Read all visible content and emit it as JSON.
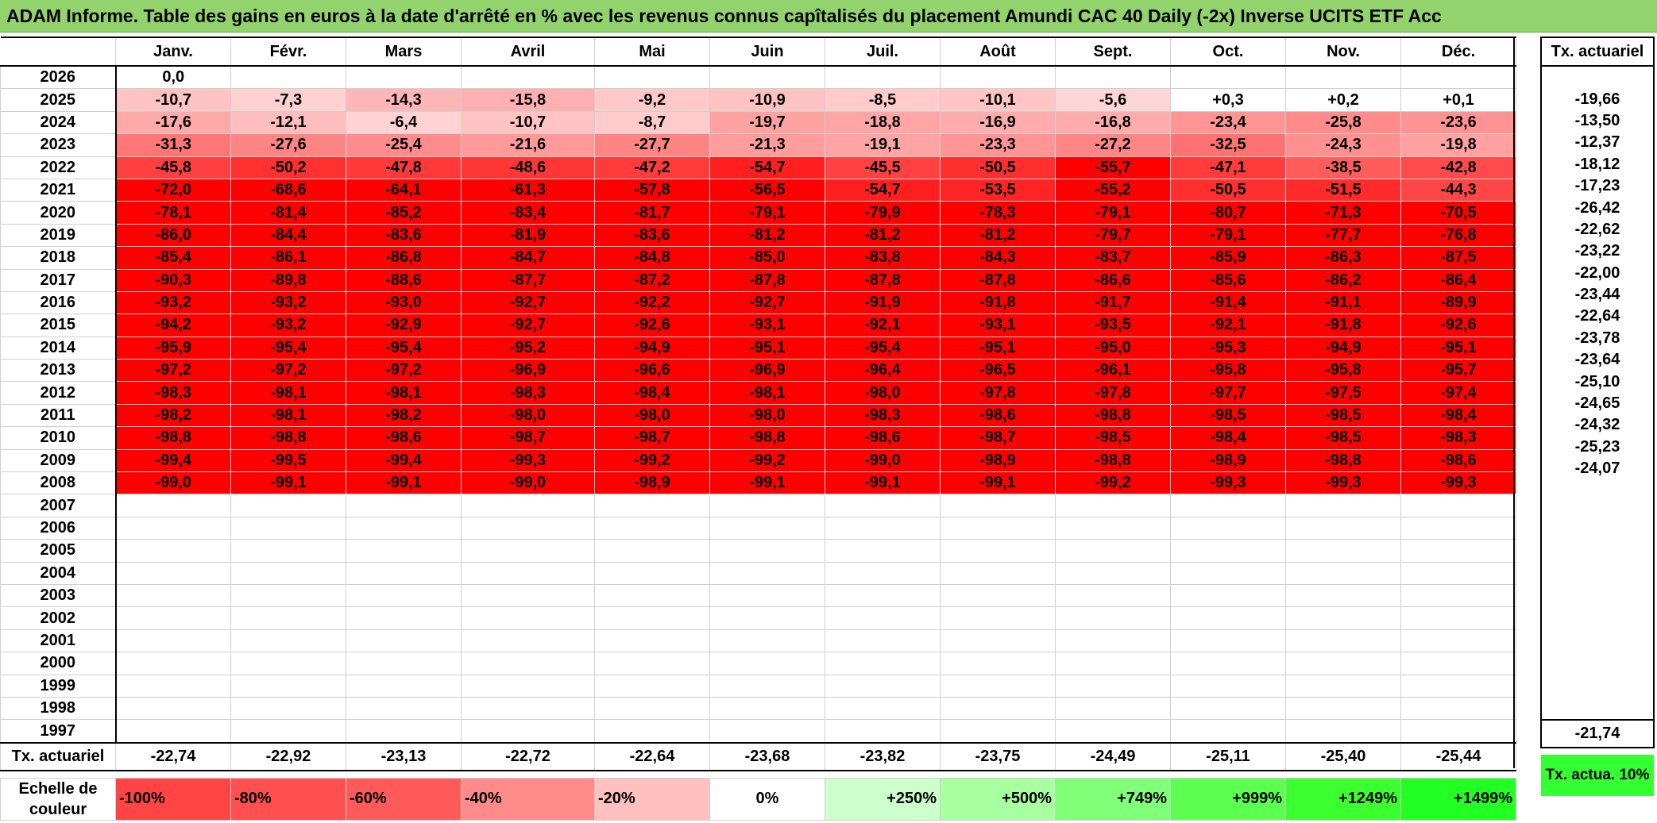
{
  "title": "ADAM Informe. Table des gains en euros à la date d'arrêté en % avec les revenus connus capîtalisés du placement Amundi CAC 40 Daily (-2x) Inverse UCITS ETF Acc",
  "months": [
    "Janv.",
    "Févr.",
    "Mars",
    "Avril",
    "Mai",
    "Juin",
    "Juil.",
    "Août",
    "Sept.",
    "Oct.",
    "Nov.",
    "Déc."
  ],
  "rate_header": "Tx. actuariel",
  "rows": [
    {
      "year": "2026",
      "values": [
        "0,0",
        "",
        "",
        "",
        "",
        "",
        "",
        "",
        "",
        "",
        "",
        ""
      ],
      "rate": ""
    },
    {
      "year": "2025",
      "values": [
        "-10,7",
        "-7,3",
        "-14,3",
        "-15,8",
        "-9,2",
        "-10,9",
        "-8,5",
        "-10,1",
        "-5,6",
        "+0,3",
        "+0,2",
        "+0,1"
      ],
      "rate": "-19,66"
    },
    {
      "year": "2024",
      "values": [
        "-17,6",
        "-12,1",
        "-6,4",
        "-10,7",
        "-8,7",
        "-19,7",
        "-18,8",
        "-16,9",
        "-16,8",
        "-23,4",
        "-25,8",
        "-23,6"
      ],
      "rate": "-13,50"
    },
    {
      "year": "2023",
      "values": [
        "-31,3",
        "-27,6",
        "-25,4",
        "-21,6",
        "-27,7",
        "-21,3",
        "-19,1",
        "-23,3",
        "-27,2",
        "-32,5",
        "-24,3",
        "-19,8"
      ],
      "rate": "-12,37"
    },
    {
      "year": "2022",
      "values": [
        "-45,8",
        "-50,2",
        "-47,8",
        "-48,6",
        "-47,2",
        "-54,7",
        "-45,5",
        "-50,5",
        "-55,7",
        "-47,1",
        "-38,5",
        "-42,8"
      ],
      "rate": "-18,12"
    },
    {
      "year": "2021",
      "values": [
        "-72,0",
        "-68,6",
        "-64,1",
        "-61,3",
        "-57,8",
        "-56,5",
        "-54,7",
        "-53,5",
        "-55,2",
        "-50,5",
        "-51,5",
        "-44,3"
      ],
      "rate": "-17,23"
    },
    {
      "year": "2020",
      "values": [
        "-78,1",
        "-81,4",
        "-85,2",
        "-83,4",
        "-81,7",
        "-79,1",
        "-79,9",
        "-78,3",
        "-79,1",
        "-80,7",
        "-71,3",
        "-70,5"
      ],
      "rate": "-26,42"
    },
    {
      "year": "2019",
      "values": [
        "-86,0",
        "-84,4",
        "-83,6",
        "-81,9",
        "-83,6",
        "-81,2",
        "-81,2",
        "-81,2",
        "-79,7",
        "-79,1",
        "-77,7",
        "-76,8"
      ],
      "rate": "-22,62"
    },
    {
      "year": "2018",
      "values": [
        "-85,4",
        "-86,1",
        "-86,8",
        "-84,7",
        "-84,8",
        "-85,0",
        "-83,8",
        "-84,3",
        "-83,7",
        "-85,9",
        "-86,3",
        "-87,5"
      ],
      "rate": "-23,22"
    },
    {
      "year": "2017",
      "values": [
        "-90,3",
        "-89,8",
        "-88,6",
        "-87,7",
        "-87,2",
        "-87,8",
        "-87,8",
        "-87,8",
        "-86,6",
        "-85,6",
        "-86,2",
        "-86,4"
      ],
      "rate": "-22,00"
    },
    {
      "year": "2016",
      "values": [
        "-93,2",
        "-93,2",
        "-93,0",
        "-92,7",
        "-92,2",
        "-92,7",
        "-91,9",
        "-91,8",
        "-91,7",
        "-91,4",
        "-91,1",
        "-89,9"
      ],
      "rate": "-23,44"
    },
    {
      "year": "2015",
      "values": [
        "-94,2",
        "-93,2",
        "-92,9",
        "-92,7",
        "-92,6",
        "-93,1",
        "-92,1",
        "-93,1",
        "-93,5",
        "-92,1",
        "-91,8",
        "-92,6"
      ],
      "rate": "-22,64"
    },
    {
      "year": "2014",
      "values": [
        "-95,9",
        "-95,4",
        "-95,4",
        "-95,2",
        "-94,9",
        "-95,1",
        "-95,4",
        "-95,1",
        "-95,0",
        "-95,3",
        "-94,9",
        "-95,1"
      ],
      "rate": "-23,78"
    },
    {
      "year": "2013",
      "values": [
        "-97,2",
        "-97,2",
        "-97,2",
        "-96,9",
        "-96,6",
        "-96,9",
        "-96,4",
        "-96,5",
        "-96,1",
        "-95,8",
        "-95,8",
        "-95,7"
      ],
      "rate": "-23,64"
    },
    {
      "year": "2012",
      "values": [
        "-98,3",
        "-98,1",
        "-98,1",
        "-98,3",
        "-98,4",
        "-98,1",
        "-98,0",
        "-97,8",
        "-97,8",
        "-97,7",
        "-97,5",
        "-97,4"
      ],
      "rate": "-25,10"
    },
    {
      "year": "2011",
      "values": [
        "-98,2",
        "-98,1",
        "-98,2",
        "-98,0",
        "-98,0",
        "-98,0",
        "-98,3",
        "-98,6",
        "-98,8",
        "-98,5",
        "-98,5",
        "-98,4"
      ],
      "rate": "-24,65"
    },
    {
      "year": "2010",
      "values": [
        "-98,8",
        "-98,8",
        "-98,6",
        "-98,7",
        "-98,7",
        "-98,8",
        "-98,6",
        "-98,7",
        "-98,5",
        "-98,4",
        "-98,5",
        "-98,3"
      ],
      "rate": "-24,32"
    },
    {
      "year": "2009",
      "values": [
        "-99,4",
        "-99,5",
        "-99,4",
        "-99,3",
        "-99,2",
        "-99,2",
        "-99,0",
        "-98,9",
        "-98,8",
        "-98,9",
        "-98,8",
        "-98,6"
      ],
      "rate": "-25,23"
    },
    {
      "year": "2008",
      "values": [
        "-99,0",
        "-99,1",
        "-99,1",
        "-99,0",
        "-98,9",
        "-99,1",
        "-99,1",
        "-99,1",
        "-99,2",
        "-99,3",
        "-99,3",
        "-99,3"
      ],
      "rate": "-24,07"
    },
    {
      "year": "2007",
      "values": [
        "",
        "",
        "",
        "",
        "",
        "",
        "",
        "",
        "",
        "",
        "",
        ""
      ],
      "rate": ""
    },
    {
      "year": "2006",
      "values": [
        "",
        "",
        "",
        "",
        "",
        "",
        "",
        "",
        "",
        "",
        "",
        ""
      ],
      "rate": ""
    },
    {
      "year": "2005",
      "values": [
        "",
        "",
        "",
        "",
        "",
        "",
        "",
        "",
        "",
        "",
        "",
        ""
      ],
      "rate": ""
    },
    {
      "year": "2004",
      "values": [
        "",
        "",
        "",
        "",
        "",
        "",
        "",
        "",
        "",
        "",
        "",
        ""
      ],
      "rate": ""
    },
    {
      "year": "2003",
      "values": [
        "",
        "",
        "",
        "",
        "",
        "",
        "",
        "",
        "",
        "",
        "",
        ""
      ],
      "rate": ""
    },
    {
      "year": "2002",
      "values": [
        "",
        "",
        "",
        "",
        "",
        "",
        "",
        "",
        "",
        "",
        "",
        ""
      ],
      "rate": ""
    },
    {
      "year": "2001",
      "values": [
        "",
        "",
        "",
        "",
        "",
        "",
        "",
        "",
        "",
        "",
        "",
        ""
      ],
      "rate": ""
    },
    {
      "year": "2000",
      "values": [
        "",
        "",
        "",
        "",
        "",
        "",
        "",
        "",
        "",
        "",
        "",
        ""
      ],
      "rate": ""
    },
    {
      "year": "1999",
      "values": [
        "",
        "",
        "",
        "",
        "",
        "",
        "",
        "",
        "",
        "",
        "",
        ""
      ],
      "rate": ""
    },
    {
      "year": "1998",
      "values": [
        "",
        "",
        "",
        "",
        "",
        "",
        "",
        "",
        "",
        "",
        "",
        ""
      ],
      "rate": ""
    },
    {
      "year": "1997",
      "values": [
        "",
        "",
        "",
        "",
        "",
        "",
        "",
        "",
        "",
        "",
        "",
        ""
      ],
      "rate": ""
    }
  ],
  "totals": {
    "label": "Tx. actuariel",
    "values": [
      "-22,74",
      "-22,92",
      "-23,13",
      "-22,72",
      "-22,64",
      "-23,68",
      "-23,82",
      "-23,75",
      "-24,49",
      "-25,11",
      "-25,40",
      "-25,44"
    ],
    "overall": "-21,74"
  },
  "scale": {
    "label": "Echelle de couleur",
    "items": [
      {
        "text": "-100%",
        "color": "#ff4444",
        "align": "left"
      },
      {
        "text": "-80%",
        "color": "#ff4f4f",
        "align": "left"
      },
      {
        "text": "-60%",
        "color": "#ff5a5a",
        "align": "left"
      },
      {
        "text": "-40%",
        "color": "#ff8a8a",
        "align": "left"
      },
      {
        "text": "-20%",
        "color": "#ffc0c0",
        "align": "left"
      },
      {
        "text": "0%",
        "color": "#ffffff",
        "align": "center"
      },
      {
        "text": "+250%",
        "color": "#ccffcc",
        "align": "right"
      },
      {
        "text": "+500%",
        "color": "#a8ffa0",
        "align": "right"
      },
      {
        "text": "+749%",
        "color": "#80ff78",
        "align": "right"
      },
      {
        "text": "+999%",
        "color": "#5cff50",
        "align": "right"
      },
      {
        "text": "+1249%",
        "color": "#3cff30",
        "align": "right"
      },
      {
        "text": "+1499%",
        "color": "#22ff22",
        "align": "right"
      }
    ],
    "rate_label": "Tx. actua. 10%",
    "rate_color": "#33ff33"
  },
  "colors": {
    "title_bg": "#92d36e",
    "negative_max": "#ff0000",
    "negative_min": "#ffffff"
  }
}
